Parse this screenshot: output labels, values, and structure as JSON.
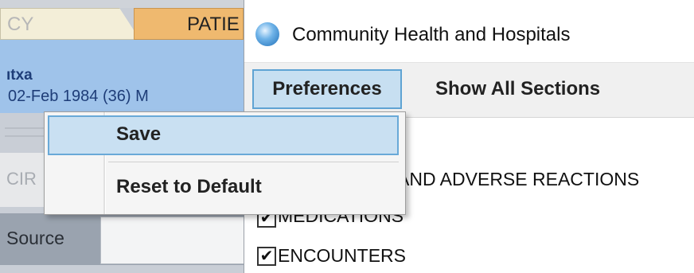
{
  "left_app": {
    "tab_inactive": "CY",
    "tab_active": "PATIE",
    "patient_name": "ıtxa",
    "patient_info": "02-Feb 1984  (36)      M",
    "cir_field_text": "CIR",
    "source_label": "Source"
  },
  "window": {
    "title": "Community Health and Hospitals"
  },
  "menu": {
    "preferences": "Preferences",
    "show_all_sections": "Show All Sections"
  },
  "dropdown": {
    "save": "Save",
    "reset": "Reset to Default"
  },
  "sections": [
    {
      "label": "AND ADVERSE REACTIONS",
      "checked": false
    },
    {
      "label": "MEDICATIONS",
      "checked": true
    },
    {
      "label": "ENCOUNTERS",
      "checked": true
    }
  ],
  "colors": {
    "accent": "#5fa3d3",
    "highlight": "#c9e0f2",
    "patient_banner": "#9fc3ea",
    "active_tab": "#efb96f"
  },
  "icons": {
    "app": "globe-icon",
    "checkbox": "checkmark-icon"
  }
}
